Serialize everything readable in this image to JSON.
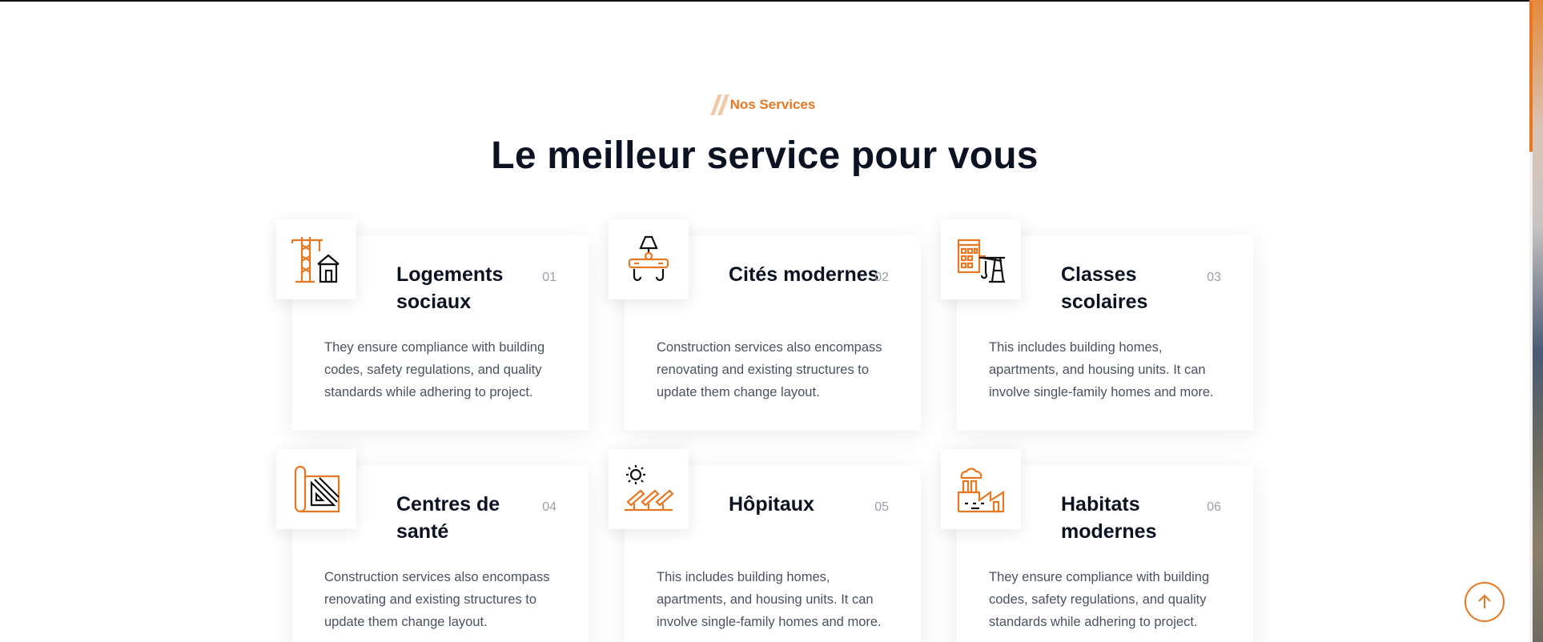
{
  "section": {
    "subtitle": "Nos Services",
    "title": "Le meilleur service pour vous"
  },
  "services": [
    {
      "title": "Logements sociaux",
      "number": "01",
      "icon": "crane-house-icon",
      "text": "They ensure compliance with building codes, safety regulations, and quality standards while adhering to project."
    },
    {
      "title": "Cités modernes",
      "number": "02",
      "icon": "lamp-platform-icon",
      "text": "Construction services also encompass renovating and existing structures to update them change layout."
    },
    {
      "title": "Classes scolaires",
      "number": "03",
      "icon": "building-crane-icon",
      "text": "This includes building homes, apartments, and housing units. It can involve single-family homes and more."
    },
    {
      "title": "Centres de santé",
      "number": "04",
      "icon": "blueprint-icon",
      "text": "Construction services also encompass renovating and existing structures to update them change layout."
    },
    {
      "title": "Hôpitaux",
      "number": "05",
      "icon": "solar-panels-icon",
      "text": "This includes building homes, apartments, and housing units. It can involve single-family homes and more."
    },
    {
      "title": "Habitats modernes",
      "number": "06",
      "icon": "factory-icon",
      "text": "They ensure compliance with building codes, safety regulations, and quality standards while adhering to project."
    }
  ],
  "colors": {
    "accent": "#e87722",
    "heading": "#0b1222",
    "text": "#4a5160",
    "number": "#9aa0a8"
  },
  "back_to_top_icon": "arrow-up-icon"
}
